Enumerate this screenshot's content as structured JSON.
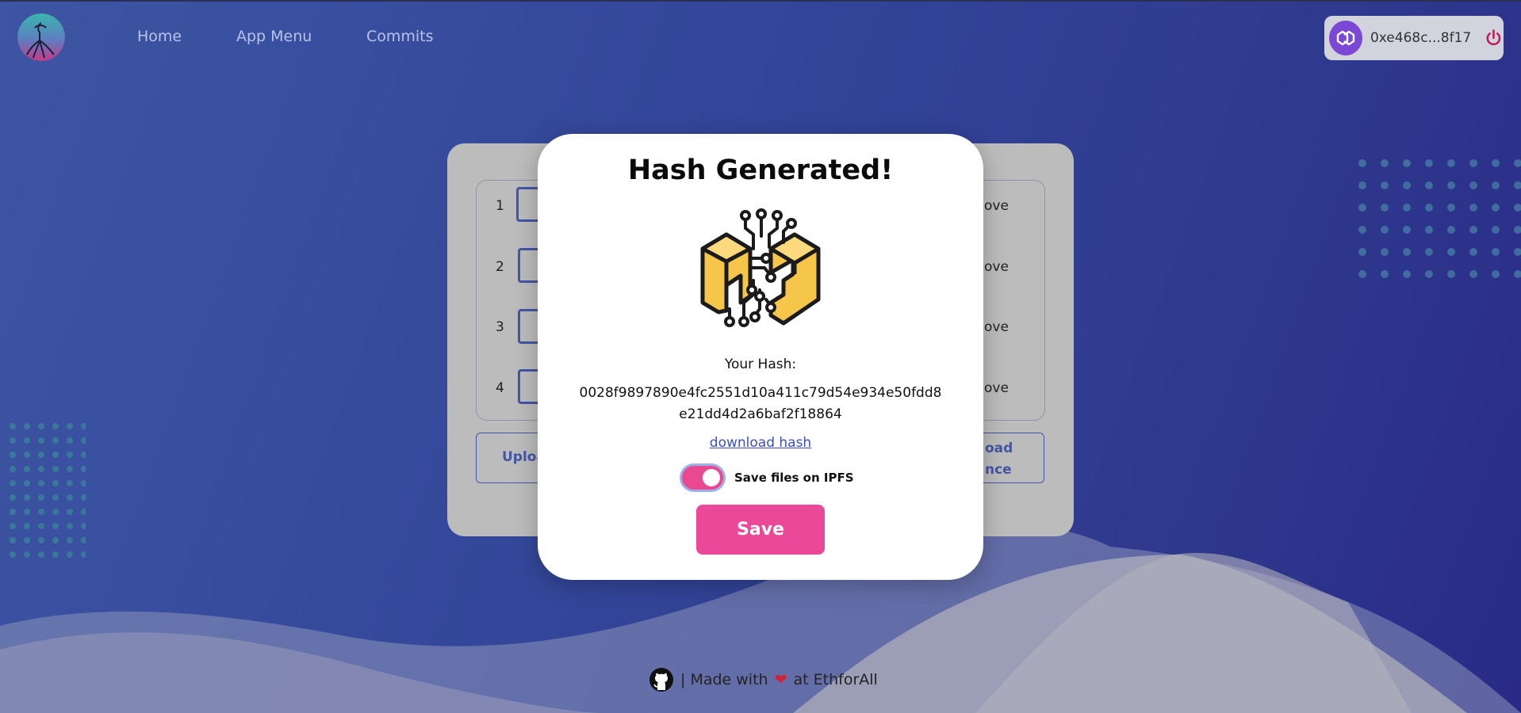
{
  "nav": {
    "links": [
      "Home",
      "App Menu",
      "Commits"
    ]
  },
  "wallet": {
    "address": "0xe468c...8f17"
  },
  "background_card": {
    "files": [
      {
        "number": "1",
        "action": "ove"
      },
      {
        "number": "2",
        "action": "ove"
      },
      {
        "number": "3",
        "action": "ove"
      },
      {
        "number": "4",
        "action": "ove"
      }
    ],
    "left_button_label": "Uploa",
    "right_button_label_1": "oad",
    "right_button_label_2": "nce"
  },
  "modal": {
    "title": "Hash Generated!",
    "hash_label": "Your Hash:",
    "hash_value": "0028f9897890e4fc2551d10a411c79d54e934e50fdd8e21dd4d2a6baf2f18864",
    "download_link": "download hash",
    "toggle_label": "Save files on IPFS",
    "toggle_on": true,
    "save_button": "Save"
  },
  "footer": {
    "text_before": "| Made with",
    "text_after": "at EthforAll"
  },
  "colors": {
    "accent_pink": "#ec4899",
    "brand_blue": "#3b4fc0",
    "background_blue": "#3448a0"
  }
}
